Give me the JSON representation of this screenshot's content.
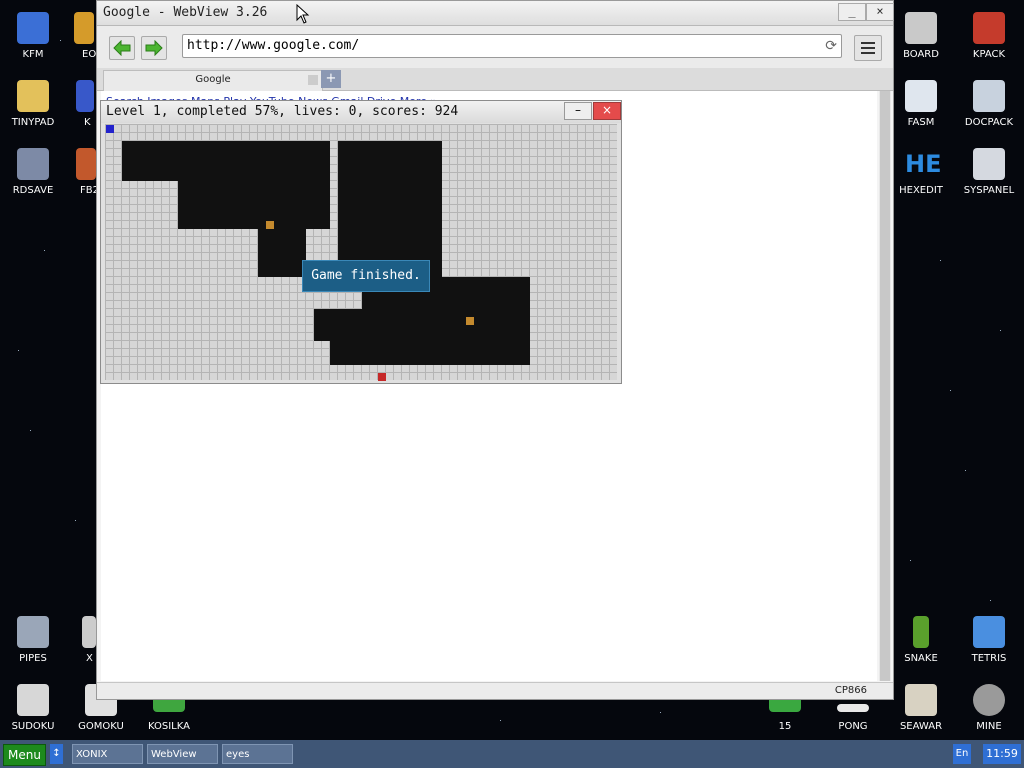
{
  "desktop": {
    "icons_left": [
      {
        "label": "KFM",
        "color": "#3b6fd6"
      },
      {
        "label": "EO",
        "color": "#d59b2a"
      },
      {
        "label": "TINYPAD",
        "color": "#e3c15b"
      },
      {
        "label": "K",
        "color": "#3858c9"
      },
      {
        "label": "RDSAVE",
        "color": "#7d8aa6"
      },
      {
        "label": "FB2",
        "color": "#c2582c"
      },
      {
        "label": "PIPES",
        "color": "#9aa6b8"
      },
      {
        "label": "X",
        "color": "#cccccc"
      },
      {
        "label": "SUDOKU",
        "color": "#d7d7d7"
      },
      {
        "label": "GOMOKU",
        "color": "#e0e0e0"
      },
      {
        "label": "KOSILKA",
        "color": "#3fa63f"
      }
    ],
    "icons_right": [
      {
        "label": "BOARD",
        "color": "#c9c9c9"
      },
      {
        "label": "KPACK",
        "color": "#c53b2c"
      },
      {
        "label": "FASM",
        "color": "#dfe6ee"
      },
      {
        "label": "DOCPACK",
        "color": "#c8d2de"
      },
      {
        "label": "HEXEDIT",
        "color": "#2d8be0"
      },
      {
        "label": "SYSPANEL",
        "color": "#d5d9e0"
      },
      {
        "label": "SNAKE",
        "color": "#5aa02c"
      },
      {
        "label": "TETRIS",
        "color": "#4a8fe0"
      },
      {
        "label": "15",
        "color": "#3aa840"
      },
      {
        "label": "PONG",
        "color": "#e8e8e8"
      },
      {
        "label": "SEAWAR",
        "color": "#d8d2c2"
      },
      {
        "label": "MINE",
        "color": "#9a9a9a"
      }
    ],
    "hexedit_glyph": "HE"
  },
  "browser": {
    "title": "Google - WebView 3.26",
    "minimize": "_",
    "close": "×",
    "url": "http://www.google.com/",
    "tab_label": "Google",
    "new_tab": "+",
    "page_links": "Search Images Maps Play YouTube News Gmail Drive More »",
    "status_right": "CP866"
  },
  "game": {
    "title": "Level 1, completed 57%, lives: 0, scores: 924",
    "minimize": "–",
    "close": "×",
    "message": "Game finished.",
    "colors": {
      "filled": "#111111",
      "ball": "#c48a2e",
      "player": "#2222cc",
      "enemy": "#c62828"
    }
  },
  "taskbar": {
    "menu": "Menu",
    "toggle": "↕",
    "items": [
      "XONIX",
      "WebView",
      "eyes"
    ],
    "language": "En",
    "clock": "11:59"
  }
}
